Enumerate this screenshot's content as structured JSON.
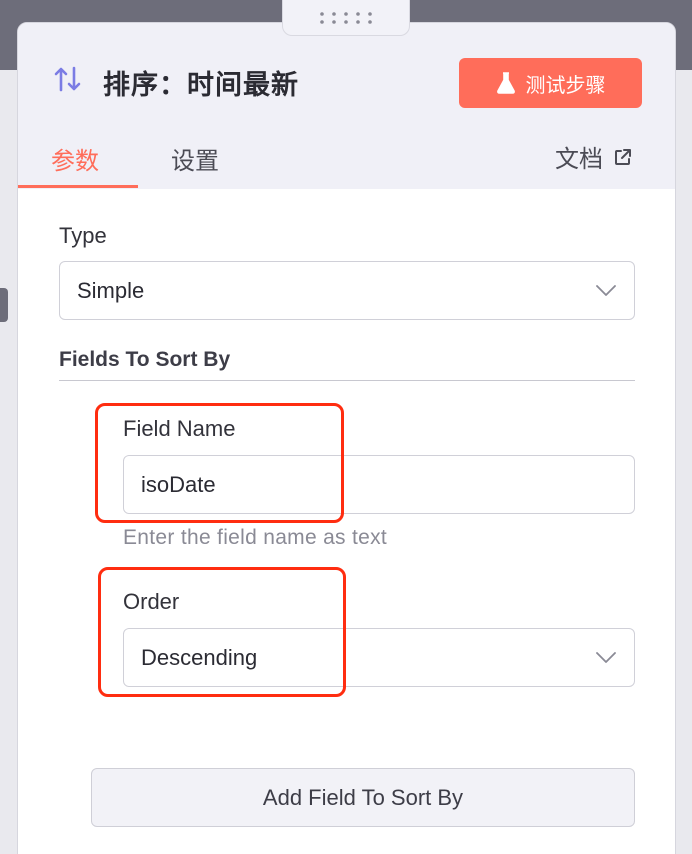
{
  "node": {
    "title": "排序：时间最新",
    "test_step_label": "测试步骤"
  },
  "tabs": {
    "params": "参数",
    "settings": "设置",
    "docs": "文档"
  },
  "fields": {
    "type_label": "Type",
    "type_value": "Simple",
    "sort_section_title": "Fields To Sort By",
    "field_name_label": "Field Name",
    "field_name_value": "isoDate",
    "field_name_hint": "Enter the field name as text",
    "order_label": "Order",
    "order_value": "Descending",
    "add_field_label": "Add Field To Sort By"
  },
  "colors": {
    "accent": "#ff6d5a",
    "highlight": "#ff2d10",
    "icon": "#7b7ce4"
  },
  "icons": [
    "grip-icon",
    "sort-arrows-icon",
    "flask-icon",
    "external-link-icon",
    "chevron-down-icon"
  ]
}
